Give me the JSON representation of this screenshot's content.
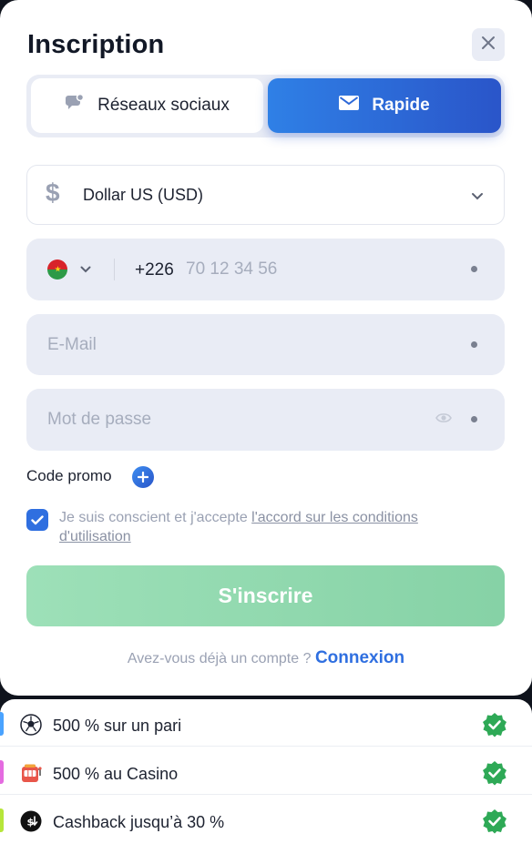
{
  "modal": {
    "title": "Inscription",
    "close_icon": "close-icon"
  },
  "tabs": [
    {
      "label": "Réseaux sociaux",
      "icon": "chat-bubbles-icon",
      "active": false
    },
    {
      "label": "Rapide",
      "icon": "envelope-icon",
      "active": true
    }
  ],
  "currency": {
    "symbol": "$",
    "label": "Dollar US (USD)",
    "icon": "chevron-down-icon"
  },
  "phone": {
    "country_flag": "burkina-faso-flag-icon",
    "dial_code": "+226",
    "placeholder": "70 12 34 56"
  },
  "email": {
    "placeholder": "E-Mail"
  },
  "password": {
    "placeholder": "Mot de passe",
    "toggle_icon": "eye-icon"
  },
  "promo": {
    "label": "Code promo",
    "icon": "plus-icon"
  },
  "terms": {
    "checked": true,
    "text": "Je suis conscient et j'accepte ",
    "link": "l'accord sur les conditions d'utilisation"
  },
  "submit": {
    "label": "S'inscrire"
  },
  "login": {
    "prompt": "Avez-vous déjà un compte ?",
    "link": "Connexion"
  },
  "bonuses": [
    {
      "text": "500 % sur un pari",
      "icon": "soccer-ball-icon",
      "bar_color": "#4aa3ff"
    },
    {
      "text": "500 % au Casino",
      "icon": "slot-machine-icon",
      "bar_color": "#e46be0"
    },
    {
      "text": "Cashback jusqu’à 30 %",
      "icon": "cashback-icon",
      "bar_color": "#b6e63a"
    }
  ],
  "colors": {
    "accent": "#2f6fe0",
    "submit": "#8fd8ae",
    "success": "#2ea956"
  }
}
